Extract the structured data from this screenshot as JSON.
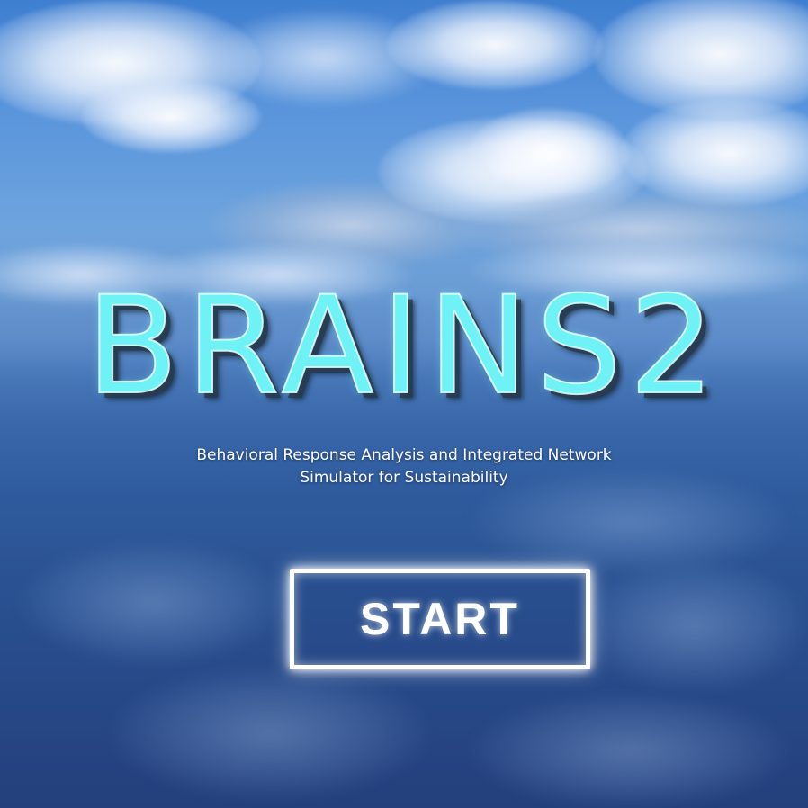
{
  "title": "BRAINS2",
  "subtitle_line1": "Behavioral Response Analysis and Integrated Network",
  "subtitle_line2": "Simulator for Sustainability",
  "start_button": {
    "label": "START"
  },
  "colors": {
    "logo": "#6ef2f6",
    "sky_top": "#3f7fd0",
    "water_bottom": "#243f7c",
    "button_border": "#ffffff"
  }
}
